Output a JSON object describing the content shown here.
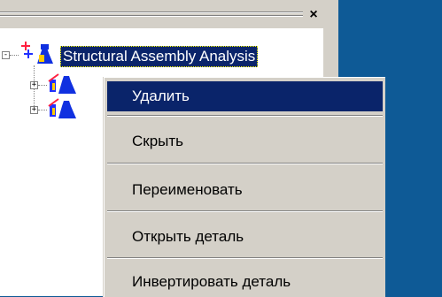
{
  "tree": {
    "root_label": "Structural Assembly Analysis",
    "root_expander": "-",
    "child_expanders": [
      "+",
      "+"
    ]
  },
  "panel": {
    "close_glyph": "×"
  },
  "context_menu": {
    "items": [
      {
        "label": "Удалить",
        "active": true
      },
      {
        "label": "Скрыть",
        "active": false
      },
      {
        "label": "Переименовать",
        "active": false
      },
      {
        "label": "Открыть деталь",
        "active": false
      },
      {
        "label": "Инвертировать деталь",
        "active": false
      }
    ]
  },
  "colors": {
    "desktop": "#0e5a96",
    "selection": "#0a246a",
    "panel": "#d4d0c8"
  },
  "icons": [
    "assembly-icon",
    "part-icon"
  ]
}
